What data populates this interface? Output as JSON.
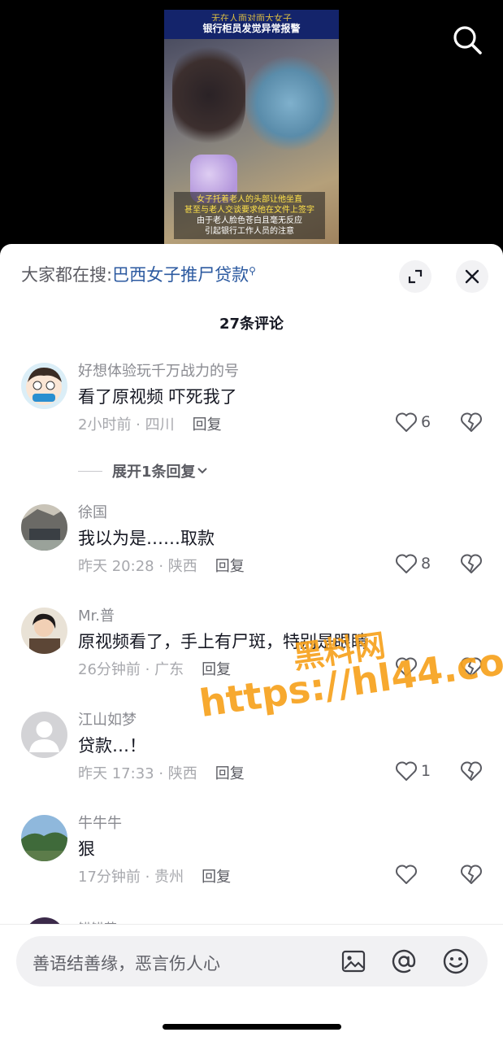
{
  "video": {
    "banner_line1": "无在人面对面大女子",
    "banner_line2": "银行柜员发觉异常报警",
    "subtitle_lines": [
      "女子托着老人的头部让他坐直",
      "甚至与老人交谈要求他在文件上签字",
      "由于老人脸色苍白且毫无反应",
      "引起银行工作人员的注意"
    ]
  },
  "header": {
    "hot_search_prefix": "大家都在搜:",
    "hot_search_term": "巴西女子推尸贷款",
    "comment_count": "27条评论"
  },
  "comments": [
    {
      "name": "好想体验玩千万战力的号",
      "text": "看了原视频 吓死我了",
      "meta": "2小时前 · 四川",
      "reply": "回复",
      "likes": "6"
    },
    {
      "name": "徐国",
      "text": "我以为是……取款",
      "meta": "昨天 20:28 · 陕西",
      "reply": "回复",
      "likes": "8"
    },
    {
      "name": "Mr.普",
      "text": "原视频看了，手上有尸斑，特别是眼睛",
      "meta": "26分钟前 · 广东",
      "reply": "回复",
      "likes": ""
    },
    {
      "name": "江山如梦",
      "text": "贷款…！",
      "meta": "昨天 17:33 · 陕西",
      "reply": "回复",
      "likes": "1"
    },
    {
      "name": "牛牛牛",
      "text": "狠",
      "meta": "17分钟前 · 贵州",
      "reply": "回复",
      "likes": ""
    }
  ],
  "more_replies": "展开1条回复",
  "peek_name": "锚锚花",
  "input": {
    "placeholder": "善语结善缘，恶言伤人心"
  },
  "icons": [
    "search-icon",
    "expand-icon",
    "close-icon",
    "heart-icon",
    "broken-heart-icon",
    "image-icon",
    "at-icon",
    "emoji-icon",
    "chevron-down-icon"
  ],
  "watermark": {
    "line1": "黑料网",
    "line2": "https://hl44.co"
  },
  "colors": {
    "link": "#2c5aa0",
    "watermark": "#f7a21e",
    "sheet": "#ffffff"
  }
}
